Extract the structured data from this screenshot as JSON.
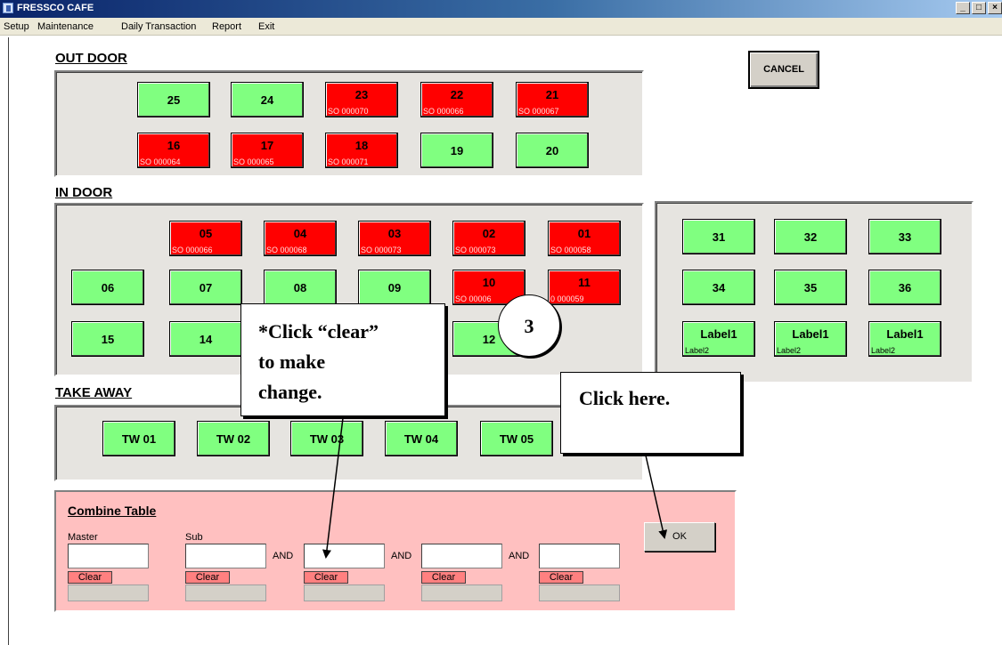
{
  "window": {
    "title": "FRESSCO CAFE",
    "min": "_",
    "max": "□",
    "close": "×"
  },
  "menu": [
    "Setup",
    "Maintenance",
    "Daily Transaction",
    "Report",
    "Exit"
  ],
  "buttons": {
    "cancel": "CANCEL",
    "ok": "OK"
  },
  "sections": {
    "outdoor": "OUT DOOR",
    "indoor": "IN DOOR",
    "takeaway": "TAKE AWAY"
  },
  "outdoor": [
    {
      "num": "25",
      "status": "free",
      "so": ""
    },
    {
      "num": "24",
      "status": "free",
      "so": ""
    },
    {
      "num": "23",
      "status": "occupied",
      "so": "SO 000070"
    },
    {
      "num": "22",
      "status": "occupied",
      "so": "SO 000066"
    },
    {
      "num": "21",
      "status": "occupied",
      "so": "SO 000067"
    },
    {
      "num": "16",
      "status": "occupied",
      "so": "SO 000064"
    },
    {
      "num": "17",
      "status": "occupied",
      "so": "SO 000065"
    },
    {
      "num": "18",
      "status": "occupied",
      "so": "SO 000071"
    },
    {
      "num": "19",
      "status": "free",
      "so": ""
    },
    {
      "num": "20",
      "status": "free",
      "so": ""
    }
  ],
  "indoor": [
    {
      "num": "05",
      "status": "occupied",
      "so": "SO 000066"
    },
    {
      "num": "04",
      "status": "occupied",
      "so": "SO 000068"
    },
    {
      "num": "03",
      "status": "occupied",
      "so": "SO 000073"
    },
    {
      "num": "02",
      "status": "occupied",
      "so": "SO 000073"
    },
    {
      "num": "01",
      "status": "occupied",
      "so": "SO 000058"
    },
    {
      "num": "06",
      "status": "free",
      "so": ""
    },
    {
      "num": "07",
      "status": "free",
      "so": ""
    },
    {
      "num": "08",
      "status": "free",
      "so": ""
    },
    {
      "num": "09",
      "status": "free",
      "so": ""
    },
    {
      "num": "10",
      "status": "occupied",
      "so": "SO 00006"
    },
    {
      "num": "11",
      "status": "occupied",
      "so": "0 000059"
    },
    {
      "num": "15",
      "status": "free",
      "so": ""
    },
    {
      "num": "14",
      "status": "free",
      "so": ""
    },
    {
      "num": "12",
      "status": "free",
      "so": ""
    }
  ],
  "indoor_right": [
    {
      "num": "31",
      "sub": ""
    },
    {
      "num": "32",
      "sub": ""
    },
    {
      "num": "33",
      "sub": ""
    },
    {
      "num": "34",
      "sub": ""
    },
    {
      "num": "35",
      "sub": ""
    },
    {
      "num": "36",
      "sub": ""
    },
    {
      "num": "Label1",
      "sub": "Label2"
    },
    {
      "num": "Label1",
      "sub": "Label2"
    },
    {
      "num": "Label1",
      "sub": "Label2"
    }
  ],
  "takeaway": [
    "TW 01",
    "TW 02",
    "TW 03",
    "TW 04",
    "TW 05"
  ],
  "combine": {
    "title": "Combine Table",
    "master_label": "Master",
    "sub_label": "Sub",
    "and_label": "AND",
    "clear_label": "Clear"
  },
  "annotations": {
    "step": "3",
    "callout1_lines": [
      "*Click “clear”",
      "to make",
      "change."
    ],
    "callout2": "Click here."
  },
  "colors": {
    "free": "#80ff80",
    "occupied": "#ff0000",
    "combine_bg": "#ffc0c0"
  }
}
